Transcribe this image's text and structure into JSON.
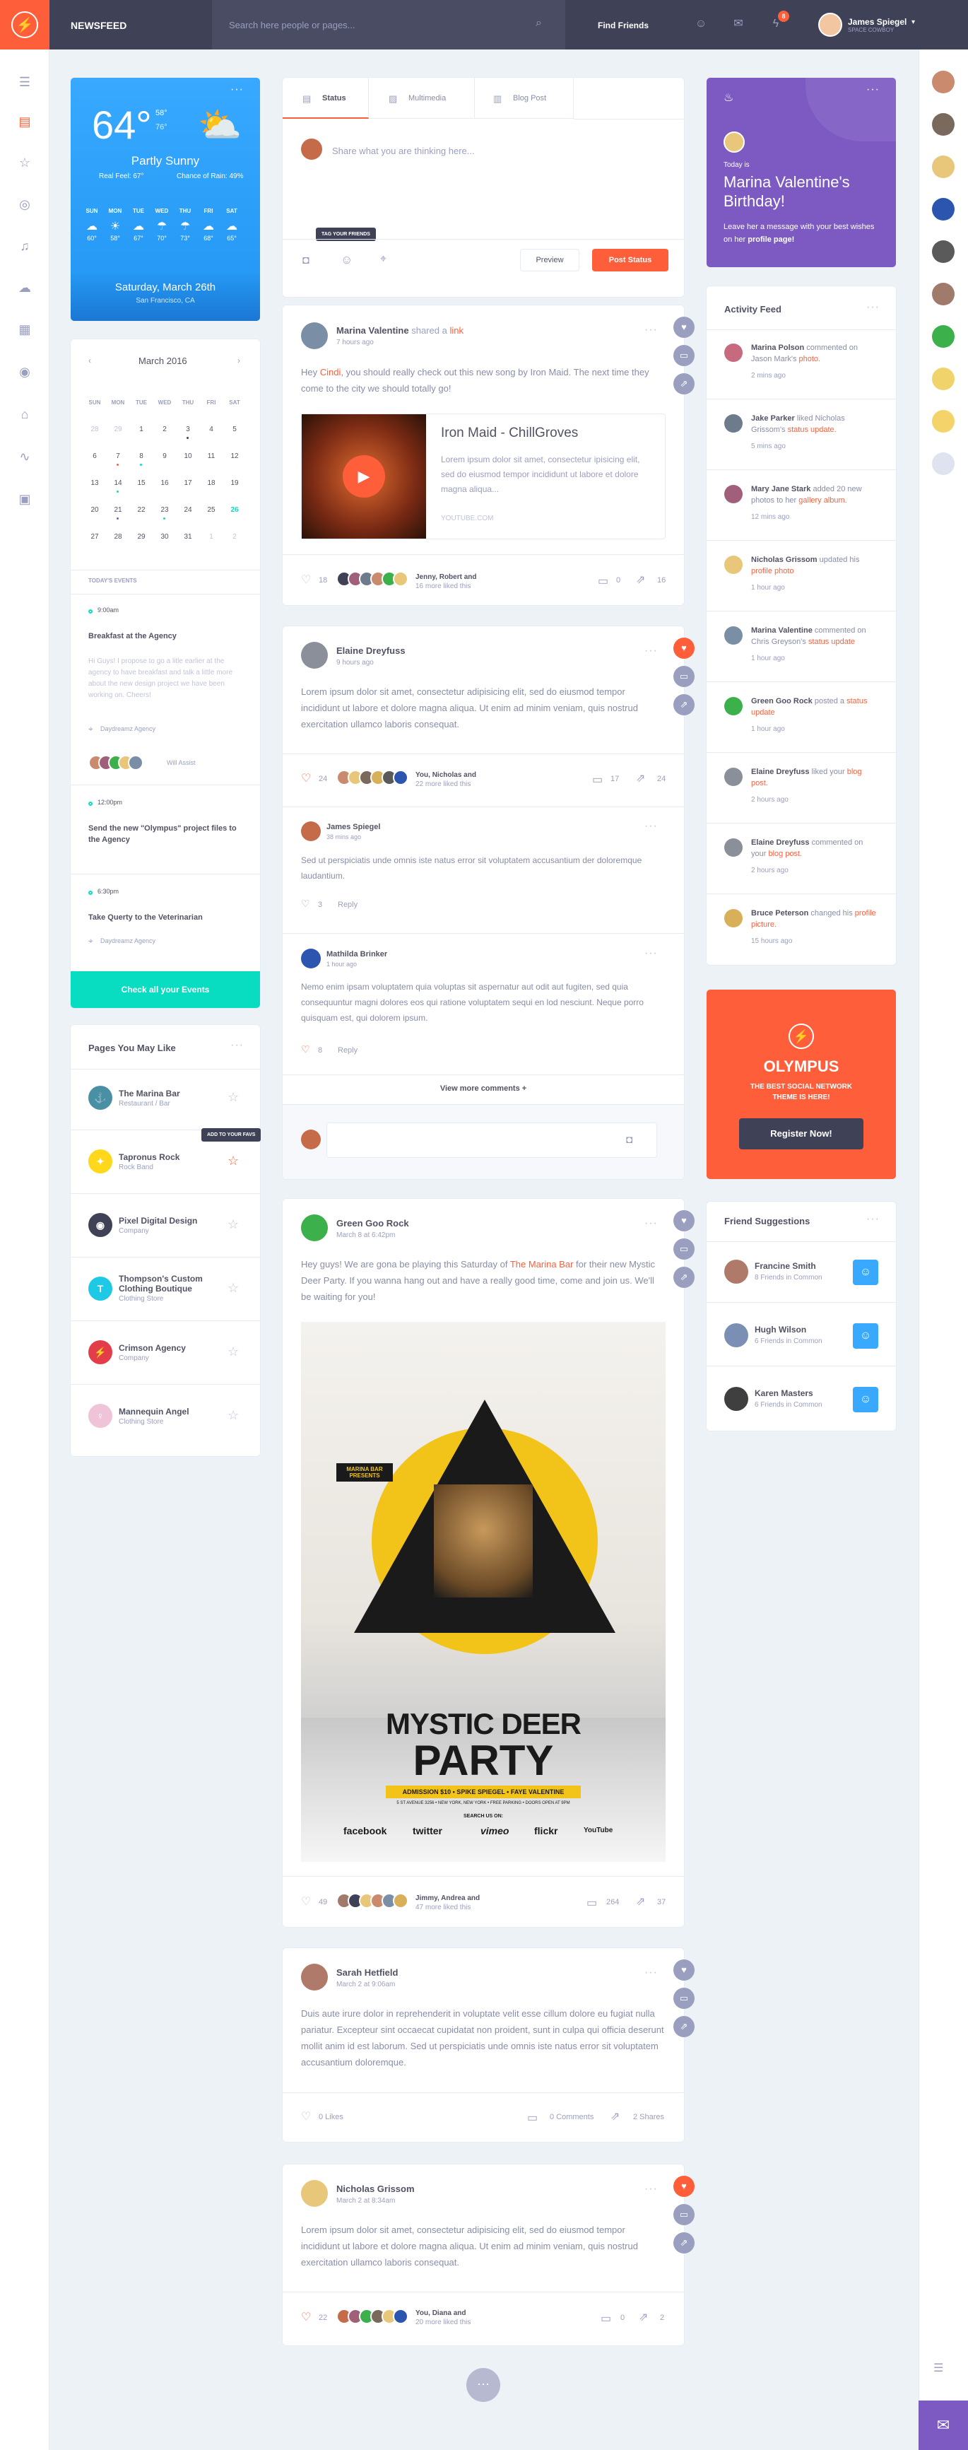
{
  "header": {
    "title": "NEWSFEED",
    "search_placeholder": "Search here people or pages...",
    "find_friends": "Find Friends",
    "notif_count": "8",
    "user_name": "James Spiegel",
    "user_subtitle": "SPACE COWBOY"
  },
  "weather": {
    "temp": "64°",
    "high": "58°",
    "low": "76°",
    "condition": "Partly Sunny",
    "feels_like": "Real Feel: 67°",
    "rain": "Chance of Rain: 49%",
    "days": [
      {
        "d": "SUN",
        "t": "60°",
        "i": "☁"
      },
      {
        "d": "MON",
        "t": "58°",
        "i": "☀"
      },
      {
        "d": "TUE",
        "t": "67°",
        "i": "☁"
      },
      {
        "d": "WED",
        "t": "70°",
        "i": "☂"
      },
      {
        "d": "THU",
        "t": "73°",
        "i": "☂"
      },
      {
        "d": "FRI",
        "t": "68°",
        "i": "☁"
      },
      {
        "d": "SAT",
        "t": "65°",
        "i": "☁"
      }
    ],
    "date": "Saturday, March 26th",
    "city": "San Francisco, CA"
  },
  "calendar": {
    "month": "March 2016",
    "dow": [
      "SUN",
      "MON",
      "TUE",
      "WED",
      "THU",
      "FRI",
      "SAT"
    ],
    "weeks": [
      [
        "28",
        "29",
        "1",
        "2",
        "3",
        "4",
        "5"
      ],
      [
        "6",
        "7",
        "8",
        "9",
        "10",
        "11",
        "12"
      ],
      [
        "13",
        "14",
        "15",
        "16",
        "17",
        "18",
        "19"
      ],
      [
        "20",
        "21",
        "22",
        "23",
        "24",
        "25",
        "26"
      ],
      [
        "27",
        "28",
        "29",
        "30",
        "31",
        "1",
        "2"
      ]
    ],
    "today_label": "TODAY'S EVENTS",
    "events": [
      {
        "time": "9:00am",
        "title": "Breakfast at the Agency",
        "desc": "Hi Guys! I propose to go a litle earlier at the agency to have breakfast and talk a little more about the new design project we have been working on. Cheers!",
        "place": "Daydreamz Agency",
        "extra": "Will Assist"
      },
      {
        "time": "12:00pm",
        "title": "Send the new \"Olympus\" project files to the Agency"
      },
      {
        "time": "6:30pm",
        "title": "Take Querty to the Veterinarian",
        "place": "Daydreamz Agency"
      }
    ],
    "button": "Check all your Events"
  },
  "pages": {
    "title": "Pages You May Like",
    "tooltip": "ADD TO YOUR FAVS",
    "items": [
      {
        "name": "The Marina Bar",
        "cat": "Restaurant / Bar",
        "color": "#4a90a4",
        "icon": "⚓"
      },
      {
        "name": "Tapronus Rock",
        "cat": "Rock Band",
        "color": "#ffd71b",
        "icon": "✦"
      },
      {
        "name": "Pixel Digital Design",
        "cat": "Company",
        "color": "#3f4257",
        "icon": "◉"
      },
      {
        "name": "Thompson's Custom Clothing Boutique",
        "cat": "Clothing Store",
        "color": "#1ec9e6",
        "icon": "T"
      },
      {
        "name": "Crimson Agency",
        "cat": "Company",
        "color": "#e33d4a",
        "icon": "⚡"
      },
      {
        "name": "Mannequin Angel",
        "cat": "Clothing Store",
        "color": "#f0c4d8",
        "icon": "♀"
      }
    ]
  },
  "composer": {
    "tabs": [
      "Status",
      "Multimedia",
      "Blog Post"
    ],
    "placeholder": "Share what you are thinking here...",
    "tag_tooltip": "TAG YOUR FRIENDS",
    "preview": "Preview",
    "post": "Post Status"
  },
  "posts": [
    {
      "author": "Marina Valentine",
      "action": "shared a",
      "action_link": "link",
      "time": "7 hours ago",
      "text_pre": "Hey ",
      "mention": "Cindi",
      "text_post": ", you should really check out this new song by Iron Maid. The next time they come to the city we should totally go!",
      "link_title": "Iron Maid - ChillGroves",
      "link_desc": "Lorem ipsum dolor sit amet, consectetur ipisicing elit, sed do eiusmod tempor incididunt ut labore et dolore magna aliqua...",
      "link_url": "YOUTUBE.COM",
      "likes": "18",
      "liked_by": "Jenny, Robert and",
      "liked_more": "16 more liked this",
      "comments": "0",
      "shares": "16"
    },
    {
      "author": "Elaine Dreyfuss",
      "time": "9 hours ago",
      "text": "Lorem ipsum dolor sit amet, consectetur adipisicing elit, sed do eiusmod tempor incididunt ut labore et dolore magna aliqua. Ut enim ad minim veniam, quis nostrud exercitation ullamco laboris consequat.",
      "likes": "24",
      "liked_by": "You, Nicholas and",
      "liked_more": "22 more liked this",
      "comments": "17",
      "shares": "24",
      "replies": [
        {
          "author": "James Spiegel",
          "time": "38 mins ago",
          "text": "Sed ut perspiciatis unde omnis iste natus error sit voluptatem accusantium der doloremque laudantium.",
          "likes": "3",
          "reply": "Reply"
        },
        {
          "author": "Mathilda Brinker",
          "time": "1 hour ago",
          "text": "Nemo enim ipsam voluptatem quia voluptas sit aspernatur aut odit aut fugiten, sed quia consequuntur magni dolores eos qui ratione voluptatem sequi en lod nesciunt. Neque porro quisquam est, qui dolorem ipsum.",
          "likes": "8",
          "reply": "Reply"
        }
      ],
      "view_more": "View more comments +"
    },
    {
      "author": "Green Goo Rock",
      "time": "March 8 at 6:42pm",
      "text_pre": "Hey guys! We are gona be playing this Saturday of ",
      "mention": "The Marina Bar",
      "text_post": " for their new Mystic Deer Party. If you wanna hang out and have a really good time, come and join us. We'll be waiting for you!",
      "poster": {
        "badge": "MARINA BAR PRESENTS",
        "title1": "MYSTIC DEER",
        "title2": "PARTY",
        "admission": "ADMISSION $10 • SPIKE SPIEGEL • FAYE VALENTINE",
        "address": "5 ST AVENUE 3256 • NEW YORK, NEW YORK • FREE PARKING • DOORS OPEN AT 9PM",
        "search": "SEARCH US ON:",
        "brands": [
          "facebook",
          "twitter",
          "vimeo",
          "flickr",
          "YouTube"
        ]
      },
      "likes": "49",
      "liked_by": "Jimmy, Andrea and",
      "liked_more": "47 more liked this",
      "comments": "264",
      "shares": "37"
    },
    {
      "author": "Sarah Hetfield",
      "time": "March 2 at 9:06am",
      "text": "Duis aute irure dolor in reprehenderit in voluptate velit esse cillum dolore eu fugiat nulla pariatur. Excepteur sint occaecat cupidatat non proident, sunt in culpa qui officia deserunt mollit anim id est laborum. Sed ut perspiciatis unde omnis iste natus error sit voluptatem accusantium doloremque.",
      "likes": "0 Likes",
      "comments": "0 Comments",
      "shares": "2 Shares"
    },
    {
      "author": "Nicholas Grissom",
      "time": "March 2 at 8:34am",
      "text": "Lorem ipsum dolor sit amet, consectetur adipisicing elit, sed do eiusmod tempor incididunt ut labore et dolore magna aliqua. Ut enim ad minim veniam, quis nostrud exercitation ullamco laboris consequat.",
      "likes": "22",
      "liked_by": "You, Diana and",
      "liked_more": "20 more liked this",
      "comments": "0",
      "shares": "2"
    }
  ],
  "valentine": {
    "today": "Today is",
    "title": "Marina Valentine's Birthday!",
    "text_pre": "Leave her a message with your best wishes on her ",
    "text_link": "profile page!"
  },
  "activity": {
    "title": "Activity Feed",
    "items": [
      {
        "pre": "",
        "who": "Marina Polson",
        "mid": " commented on Jason Mark's ",
        "link": "photo.",
        "time": "2 mins ago",
        "color": "#c76a7e"
      },
      {
        "pre": "",
        "who": "Jake Parker",
        "mid": " liked Nicholas Grissom's ",
        "link": "status update.",
        "time": "5 mins ago",
        "color": "#6d7b8d"
      },
      {
        "pre": "",
        "who": "Mary Jane Stark",
        "mid": " added 20 new photos to her ",
        "link": "gallery album.",
        "time": "12 mins ago",
        "color": "#a0607a"
      },
      {
        "pre": "",
        "who": "Nicholas Grissom",
        "mid": " updated his ",
        "link": "profile photo",
        "time": "1 hour ago",
        "color": "#e8c77a"
      },
      {
        "pre": "",
        "who": "Marina Valentine",
        "mid": " commented on Chris Greyson's ",
        "link": "status update",
        "time": "1 hour ago",
        "color": "#7a8fa6"
      },
      {
        "pre": "",
        "who": "Green Goo Rock",
        "mid": " posted a ",
        "link": "status update",
        "time": "1 hour ago",
        "color": "#3cb04a"
      },
      {
        "pre": "",
        "who": "Elaine Dreyfuss",
        "mid": " liked your ",
        "link": "blog post.",
        "time": "2 hours ago",
        "color": "#8a8f99"
      },
      {
        "pre": "",
        "who": "Elaine Dreyfuss",
        "mid": " commented on your ",
        "link": "blog post.",
        "time": "2 hours ago",
        "color": "#8a8f99"
      },
      {
        "pre": "",
        "who": "Bruce Peterson",
        "mid": " changed his ",
        "link": "profile picture.",
        "time": "15 hours ago",
        "color": "#d9b05a"
      }
    ]
  },
  "olympus": {
    "name": "OLYMPUS",
    "tagline": "THE BEST SOCIAL NETWORK THEME IS HERE!",
    "button": "Register Now!"
  },
  "suggestions": {
    "title": "Friend Suggestions",
    "items": [
      {
        "name": "Francine Smith",
        "common": "8 Friends in Common",
        "color": "#b07a6a"
      },
      {
        "name": "Hugh Wilson",
        "common": "6 Friends in Common",
        "color": "#7a8fb3"
      },
      {
        "name": "Karen Masters",
        "common": "6 Friends in Common",
        "color": "#3f3f3f"
      }
    ]
  },
  "colors": {
    "accent": "#ff5e3a",
    "blue": "#38a9ff",
    "purple": "#7c5ac2",
    "dark": "#3f4257",
    "teal": "#08ddc1"
  }
}
